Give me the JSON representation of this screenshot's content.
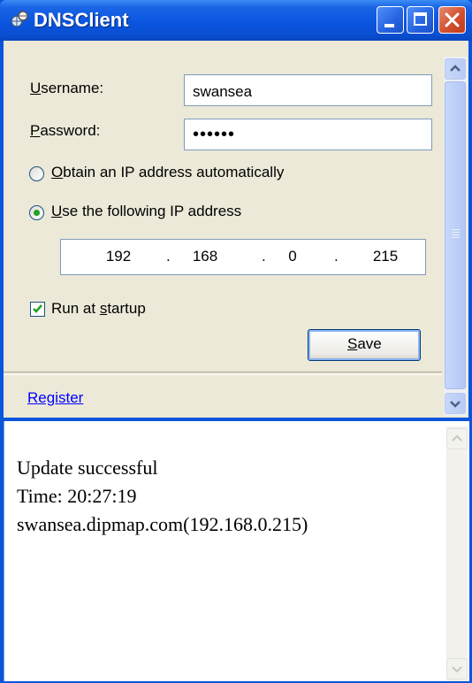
{
  "window": {
    "title": "DNSClient",
    "icon": "network-globe-icon",
    "buttons": [
      "minimize",
      "maximize",
      "close"
    ]
  },
  "form": {
    "username_label": "Username:",
    "username_access_key": "U",
    "username_value": "swansea",
    "password_label": "Password:",
    "password_access_key": "P",
    "password_value": "••••••",
    "radio_auto_label": "Obtain an IP address automatically",
    "radio_auto_checked": false,
    "radio_manual_label": "Use the following IP address",
    "radio_manual_checked": true,
    "ip_octets": [
      "192",
      "168",
      "0",
      "215"
    ],
    "run_startup_label": "Run at startup",
    "run_startup_checked": true,
    "save_label": "Save",
    "register_link": "Register"
  },
  "log": {
    "lines": [
      "Update successful",
      "Time: 20:27:19",
      "swansea.dipmap.com(192.168.0.215)"
    ]
  },
  "colors": {
    "titlebar": "#0a55e0",
    "panel": "#ece9d8",
    "link": "#0000ff",
    "close_button": "#d4502f"
  }
}
